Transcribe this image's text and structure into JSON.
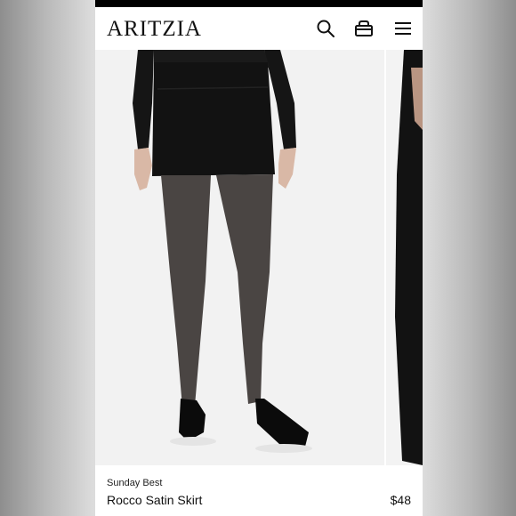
{
  "header": {
    "logo": "ARITZIA",
    "icons": [
      "search-icon",
      "shopping-bag-icon",
      "hamburger-menu-icon"
    ]
  },
  "product": {
    "brand": "Sunday Best",
    "name": "Rocco Satin Skirt",
    "price": "$48"
  },
  "colors": {
    "accent": "#111111",
    "page_background": "#dcdcdc",
    "photo_background": "#f2f2f2"
  }
}
